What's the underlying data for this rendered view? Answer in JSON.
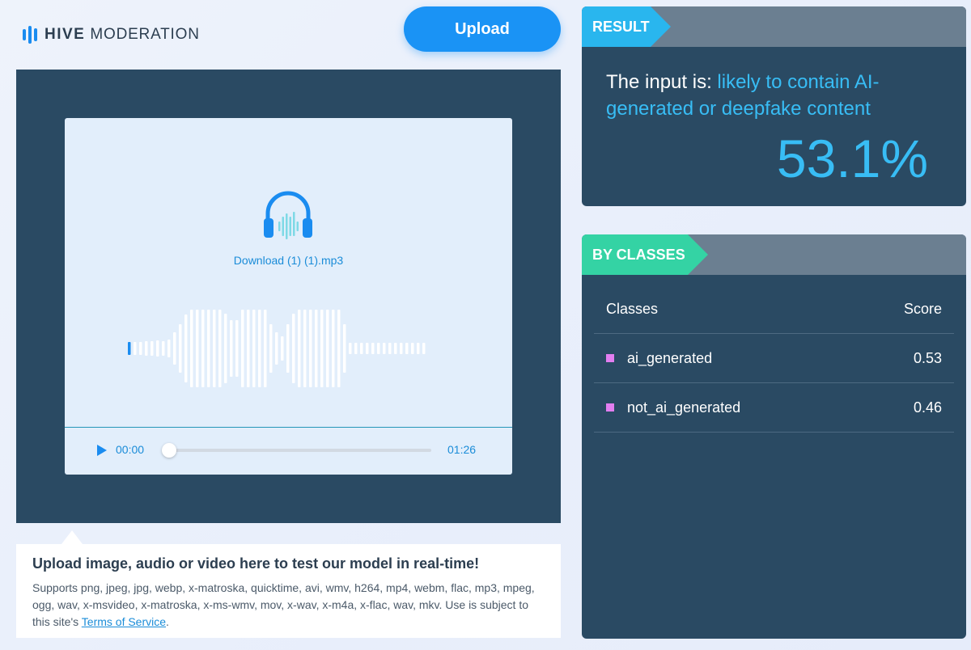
{
  "logo": {
    "brand": "HIVE",
    "product": "MODERATION"
  },
  "upload": {
    "label": "Upload"
  },
  "player": {
    "filename": "Download (1) (1).mp3",
    "current_time": "00:00",
    "duration": "01:26",
    "progress": 0
  },
  "info": {
    "title": "Upload image, audio or video here to test our model in real-time!",
    "desc": "Supports png, jpeg, jpg, webp, x-matroska, quicktime, avi, wmv, h264, mp4, webm, flac, mp3, mpeg, ogg, wav, x-msvideo, x-matroska, x-ms-wmv, mov, x-wav, x-m4a, x-flac, wav, mkv. Use is subject to this site's ",
    "tos_label": "Terms of Service",
    "tos_after": "."
  },
  "result": {
    "tag": "RESULT",
    "prefix": "The input is: ",
    "verdict": "likely to contain AI-generated or deepfake content",
    "percent": "53.1%"
  },
  "classes": {
    "tag": "BY CLASSES",
    "header_class": "Classes",
    "header_score": "Score",
    "rows": [
      {
        "name": "ai_generated",
        "score": "0.53",
        "color": "#e27ef0"
      },
      {
        "name": "not_ai_generated",
        "score": "0.46",
        "color": "#e27ef0"
      }
    ]
  },
  "colors": {
    "accent": "#1a93f5",
    "panel": "#2a4a63",
    "result_tag": "#29b6ee",
    "classes_tag": "#34d3a4"
  }
}
